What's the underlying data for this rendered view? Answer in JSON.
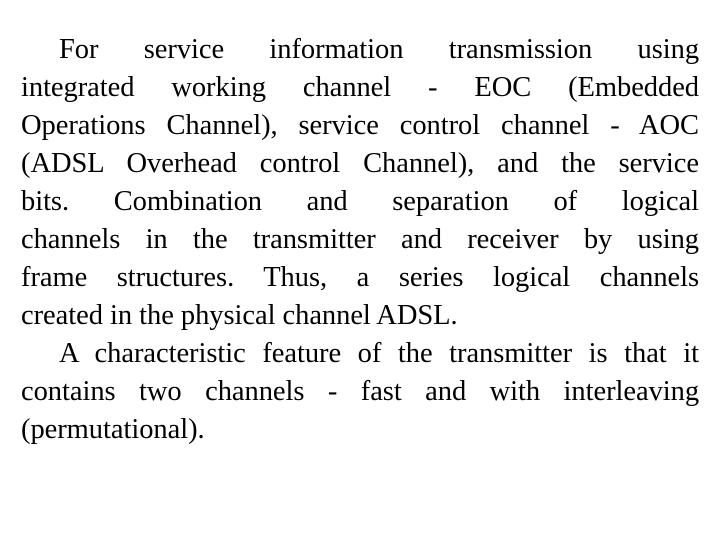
{
  "slide": {
    "background_color": "#ffffff",
    "text_color": "#000000",
    "paragraphs": [
      {
        "id": "paragraph-1",
        "full_text": "For service information transmission using integrated working channel - EOC (Embedded Operations Channel), service control channel - AOC (ADSL Overhead control Channel), and the service bits. Combination and separation of logical channels in the transmitter and receiver by using frame structures. Thus, a series logical channels created in the physical channel ADSL.",
        "first_line_indent": true,
        "lines": [
          "For service information transmission using",
          "integrated working channel - EOC (Embedded",
          "Operations Channel), service control channel - AOC",
          "(ADSL Overhead control Channel), and the service",
          "bits. Combination and separation of logical",
          "channels in the transmitter and receiver by using",
          "frame structures. Thus, a series logical channels",
          "created in the physical channel ADSL."
        ]
      },
      {
        "id": "paragraph-2",
        "full_text": "A characteristic feature of the transmitter is that it contains two channels - fast and with interleaving (permutational).",
        "first_line_indent": true,
        "lines": [
          "A characteristic feature of the transmitter is that it",
          "contains two channels - fast and with interleaving",
          "(permutational)."
        ]
      }
    ]
  }
}
